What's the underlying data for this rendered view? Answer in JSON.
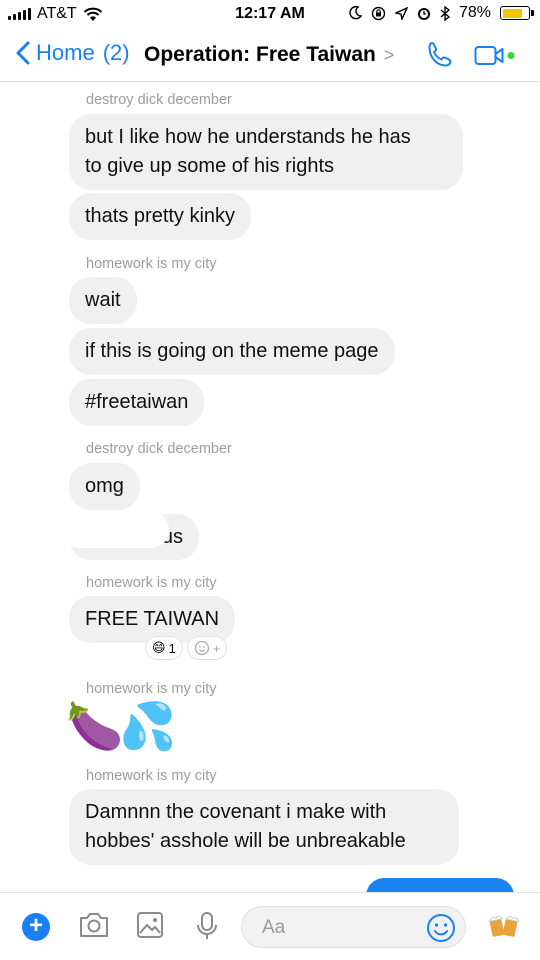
{
  "status_bar": {
    "carrier": "AT&T",
    "time": "12:17 AM",
    "battery": "78%",
    "battery_level": 0.78
  },
  "nav": {
    "back_label": "Home",
    "unread_count": "(2)",
    "title": "Operation: Free Taiwan",
    "chevron": ">"
  },
  "messages": [
    {
      "sender": "destroy dick december"
    },
    {
      "text": "but I like how he understands he has\nto give up some of his rights"
    },
    {
      "text": "thats pretty kinky"
    },
    {
      "sender": "homework is my city"
    },
    {
      "text": "wait"
    },
    {
      "text": "if this is going on the meme page"
    },
    {
      "text": "#freetaiwan"
    },
    {
      "sender": "destroy dick december"
    },
    {
      "text": "omg"
    },
    {
      "text": "us"
    },
    {
      "sender": "homework is my city"
    },
    {
      "text": "FREE TAIWAN"
    },
    {
      "sender": "homework is my city"
    },
    {
      "emoji": "🍆💦"
    },
    {
      "sender": "homework is my city"
    },
    {
      "text": "Damnnn the covenant i make with\nhobbes' asshole will be unbreakable"
    }
  ],
  "reaction": {
    "emoji": "😄",
    "count": "1",
    "add": "+"
  },
  "composer": {
    "placeholder": "Aa"
  },
  "icons": [
    "back-chevron-icon",
    "phone-icon",
    "video-icon",
    "plus-icon",
    "camera-icon",
    "gallery-icon",
    "microphone-icon",
    "smiley-icon",
    "beer-icon"
  ]
}
